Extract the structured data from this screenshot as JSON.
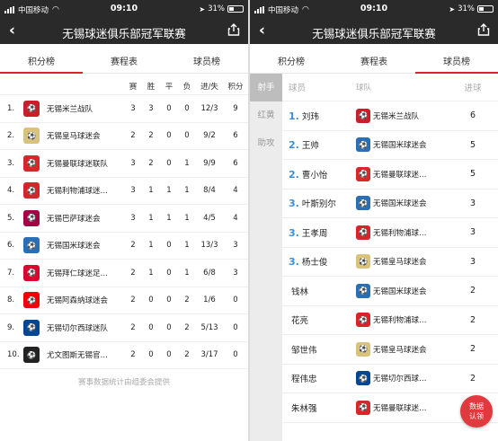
{
  "status": {
    "carrier": "中国移动",
    "time": "09:10",
    "battery": "31%"
  },
  "nav": {
    "title": "无锡球迷俱乐部冠军联赛"
  },
  "tabs": [
    "积分榜",
    "赛程表",
    "球员榜"
  ],
  "standings": {
    "headers": [
      "赛",
      "胜",
      "平",
      "负",
      "进/失",
      "积分"
    ],
    "rows": [
      {
        "rank": "1.",
        "team": "无锡米兰战队",
        "p": "3",
        "w": "3",
        "d": "0",
        "l": "0",
        "gd": "12/3",
        "pts": "9",
        "color": "#c8202a"
      },
      {
        "rank": "2.",
        "team": "无锡皇马球迷会",
        "p": "2",
        "w": "2",
        "d": "0",
        "l": "0",
        "gd": "9/2",
        "pts": "6",
        "color": "#d9c27a"
      },
      {
        "rank": "3.",
        "team": "无锡曼联球迷联队",
        "p": "3",
        "w": "2",
        "d": "0",
        "l": "1",
        "gd": "9/9",
        "pts": "6",
        "color": "#d62828"
      },
      {
        "rank": "4.",
        "team": "无锡利物浦球迷…",
        "p": "3",
        "w": "1",
        "d": "1",
        "l": "1",
        "gd": "8/4",
        "pts": "4",
        "color": "#d8232a"
      },
      {
        "rank": "5.",
        "team": "无锡巴萨球迷会",
        "p": "3",
        "w": "1",
        "d": "1",
        "l": "1",
        "gd": "4/5",
        "pts": "4",
        "color": "#a50044"
      },
      {
        "rank": "6.",
        "team": "无锡国米球迷会",
        "p": "2",
        "w": "1",
        "d": "0",
        "l": "1",
        "gd": "13/3",
        "pts": "3",
        "color": "#2a6fb4"
      },
      {
        "rank": "7.",
        "team": "无锡拜仁球迷足…",
        "p": "2",
        "w": "1",
        "d": "0",
        "l": "1",
        "gd": "6/8",
        "pts": "3",
        "color": "#dc052d"
      },
      {
        "rank": "8.",
        "team": "无锡阿森纳球迷会",
        "p": "2",
        "w": "0",
        "d": "0",
        "l": "2",
        "gd": "1/6",
        "pts": "0",
        "color": "#ef0107"
      },
      {
        "rank": "9.",
        "team": "无锡切尔西球迷队",
        "p": "2",
        "w": "0",
        "d": "0",
        "l": "2",
        "gd": "5/13",
        "pts": "0",
        "color": "#034694"
      },
      {
        "rank": "10.",
        "team": "尤文图斯无锡官…",
        "p": "2",
        "w": "0",
        "d": "0",
        "l": "2",
        "gd": "3/17",
        "pts": "0",
        "color": "#222222"
      }
    ],
    "footnote": "赛事数据统计由组委会提供"
  },
  "scorers": {
    "side": [
      "射手",
      "红黄",
      "助攻"
    ],
    "headers": [
      "球员",
      "球队",
      "进球"
    ],
    "rows": [
      {
        "rank": "1.",
        "name": "刘玮",
        "team": "无锡米兰战队",
        "goals": "6",
        "color": "#c8202a"
      },
      {
        "rank": "2.",
        "name": "王帅",
        "team": "无锡国米球迷会",
        "goals": "5",
        "color": "#2a6fb4"
      },
      {
        "rank": "2.",
        "name": "曹小怡",
        "team": "无锡曼联球迷…",
        "goals": "5",
        "color": "#d62828"
      },
      {
        "rank": "3.",
        "name": "叶斯别尔",
        "team": "无锡国米球迷会",
        "goals": "3",
        "color": "#2a6fb4"
      },
      {
        "rank": "3.",
        "name": "王孝周",
        "team": "无锡利物浦球…",
        "goals": "3",
        "color": "#d8232a"
      },
      {
        "rank": "3.",
        "name": "杨士俊",
        "team": "无锡皇马球迷会",
        "goals": "3",
        "color": "#d9c27a"
      },
      {
        "rank": "",
        "name": "钱林",
        "team": "无锡国米球迷会",
        "goals": "2",
        "color": "#2a6fb4"
      },
      {
        "rank": "",
        "name": "花亮",
        "team": "无锡利物浦球…",
        "goals": "2",
        "color": "#d8232a"
      },
      {
        "rank": "",
        "name": "邹世伟",
        "team": "无锡皇马球迷会",
        "goals": "2",
        "color": "#d9c27a"
      },
      {
        "rank": "",
        "name": "程伟忠",
        "team": "无锡切尔西球…",
        "goals": "2",
        "color": "#034694"
      },
      {
        "rank": "",
        "name": "朱林强",
        "team": "无锡曼联球迷…",
        "goals": "2",
        "color": "#d62828"
      }
    ]
  },
  "fab": {
    "line1": "数据",
    "line2": "认领"
  },
  "colors": {
    "accent": "#d6262b",
    "bar": "#2a2a2a",
    "rank_blue": "#3a8fd6"
  }
}
